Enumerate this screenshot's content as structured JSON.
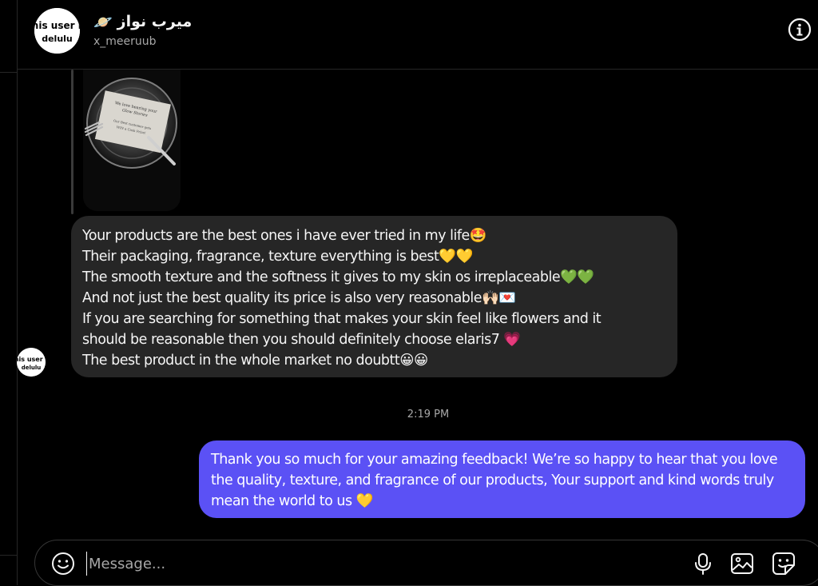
{
  "header": {
    "display_name": "ميرب نواز",
    "name_emoji": "🪐",
    "username": "x_meeruub",
    "avatar_text_top": "this user is",
    "avatar_text_bottom": "delulu"
  },
  "conversation": {
    "incoming": {
      "lines": [
        "Your products are the best ones i have ever tried in my life🤩",
        "Their packaging, fragrance, texture everything is best💛💛",
        "The smooth texture and the softness it gives to my skin os irreplaceable💚💚",
        "And not just the best quality its price is also very reasonable🙌🏻💌",
        "If you are searching for something that makes your skin feel like flowers and it",
        "should be reasonable then you should definitely choose elaris7 💗",
        "The best product in the whole market no doubtt😀😀"
      ]
    },
    "timestamp": "2:19 PM",
    "outgoing": {
      "text": "Thank you so much for your amazing feedback! We’re so happy to hear that you love the quality, texture, and fragrance of our products, Your support and kind words truly mean the world to us 💛"
    }
  },
  "photo_card": {
    "line1": "We love hearing your",
    "line2": "Glow Stories",
    "line3": "Our Best customer gets",
    "line4": "WIN a Cash Prize!"
  },
  "composer": {
    "placeholder": "Message..."
  },
  "icons": {
    "info": "info-icon",
    "emoji": "emoji-icon",
    "mic": "microphone-icon",
    "gallery": "image-icon",
    "sticker": "sticker-icon"
  },
  "colors": {
    "background": "#000000",
    "incoming_bubble": "#262626",
    "outgoing_bubble": "#5b51f5",
    "muted_text": "#a8a8a8"
  }
}
